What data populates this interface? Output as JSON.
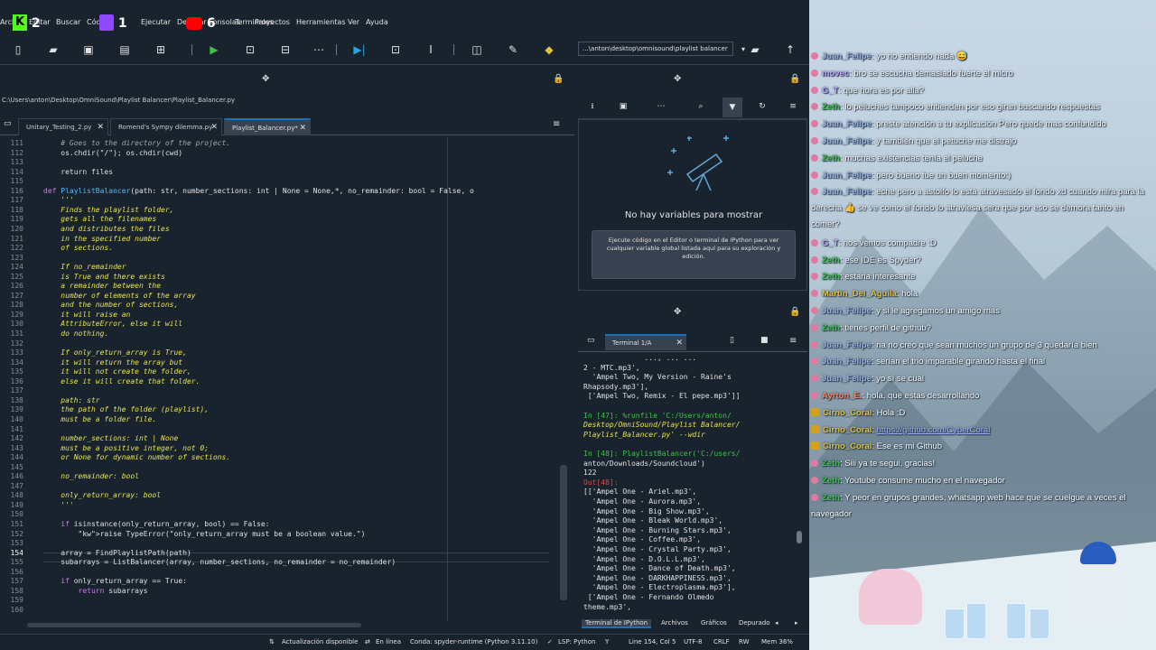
{
  "menu": {
    "items": [
      "Archivo",
      "Editar",
      "Buscar",
      "Código",
      "Ejecutar",
      "Depurar",
      "Consolas",
      "Terminales",
      "Proyectos",
      "Herramientas",
      "Ver",
      "Ayuda"
    ]
  },
  "overlay": {
    "k_count": "2",
    "tw_count": "1",
    "yt_count": "6"
  },
  "toolbar": {
    "path": "...\\anton\\desktop\\omnisound\\playlist balancer"
  },
  "editor": {
    "path": "C:\\Users\\anton\\Desktop\\OmniSound\\Playlist Balancer\\Playlist_Balancer.py",
    "tabs": [
      {
        "label": "Unitary_Testing_2.py"
      },
      {
        "label": "Romend's Sympy dilemma.py"
      },
      {
        "label": "Playlist_Balancer.py*"
      }
    ],
    "lines": [
      {
        "n": "111",
        "t": "    # Goes to the directory of the project.",
        "c": "cm"
      },
      {
        "n": "112",
        "t": "    os.chdir(\"/\"); os.chdir(cwd)",
        "c": ""
      },
      {
        "n": "113",
        "t": "",
        "c": ""
      },
      {
        "n": "114",
        "t": "    return files",
        "c": ""
      },
      {
        "n": "115",
        "t": "",
        "c": ""
      },
      {
        "n": "116",
        "t": "def PlaylistBalancer(path: str, number_sections: int | None = None,*, no_remainder: bool = False, o",
        "c": "def"
      },
      {
        "n": "117",
        "t": "    '''",
        "c": "doc"
      },
      {
        "n": "118",
        "t": "    Finds the playlist folder,",
        "c": "doc"
      },
      {
        "n": "119",
        "t": "    gets all the filenames",
        "c": "doc"
      },
      {
        "n": "120",
        "t": "    and distributes the files",
        "c": "doc"
      },
      {
        "n": "121",
        "t": "    in the specified number",
        "c": "doc"
      },
      {
        "n": "122",
        "t": "    of sections.",
        "c": "doc"
      },
      {
        "n": "123",
        "t": "",
        "c": ""
      },
      {
        "n": "124",
        "t": "    If no_remainder",
        "c": "doc"
      },
      {
        "n": "125",
        "t": "    is True and there exists",
        "c": "doc"
      },
      {
        "n": "126",
        "t": "    a remainder between the",
        "c": "doc"
      },
      {
        "n": "127",
        "t": "    number of elements of the array",
        "c": "doc"
      },
      {
        "n": "128",
        "t": "    and the number of sections,",
        "c": "doc"
      },
      {
        "n": "129",
        "t": "    it will raise an",
        "c": "doc"
      },
      {
        "n": "130",
        "t": "    AttributeError, else it will",
        "c": "doc"
      },
      {
        "n": "131",
        "t": "    do nothing.",
        "c": "doc"
      },
      {
        "n": "132",
        "t": "",
        "c": ""
      },
      {
        "n": "133",
        "t": "    If only_return_array is True,",
        "c": "doc"
      },
      {
        "n": "134",
        "t": "    it will return the array but",
        "c": "doc"
      },
      {
        "n": "135",
        "t": "    it will not create the folder,",
        "c": "doc"
      },
      {
        "n": "136",
        "t": "    else it will create that folder.",
        "c": "doc"
      },
      {
        "n": "137",
        "t": "",
        "c": ""
      },
      {
        "n": "138",
        "t": "    path: str",
        "c": "doc"
      },
      {
        "n": "139",
        "t": "    the path of the folder (playlist),",
        "c": "doc"
      },
      {
        "n": "140",
        "t": "    must be a folder file.",
        "c": "doc"
      },
      {
        "n": "141",
        "t": "",
        "c": ""
      },
      {
        "n": "142",
        "t": "    number_sections: int | None",
        "c": "doc"
      },
      {
        "n": "143",
        "t": "    must be a positive integer, not 0;",
        "c": "doc"
      },
      {
        "n": "144",
        "t": "    or None for dynamic number of sections.",
        "c": "doc"
      },
      {
        "n": "145",
        "t": "",
        "c": ""
      },
      {
        "n": "146",
        "t": "    no_remainder: bool",
        "c": "doc"
      },
      {
        "n": "147",
        "t": "",
        "c": ""
      },
      {
        "n": "148",
        "t": "    only_return_array: bool",
        "c": "doc"
      },
      {
        "n": "149",
        "t": "    '''",
        "c": "doc"
      },
      {
        "n": "150",
        "t": "",
        "c": ""
      },
      {
        "n": "151",
        "t": "    if isinstance(only_return_array, bool) == False:",
        "c": "if"
      },
      {
        "n": "152",
        "t": "        raise TypeError(\"only_return_array must be a boolean value.\")",
        "c": "raise"
      },
      {
        "n": "153",
        "t": "",
        "c": ""
      },
      {
        "n": "154",
        "t": "    array = FindPlaylistPath(path)",
        "c": ""
      },
      {
        "n": "155",
        "t": "    subarrays = ListBalancer(array, number_sections, no_remainder = no_remainder)",
        "c": ""
      },
      {
        "n": "156",
        "t": "",
        "c": ""
      },
      {
        "n": "157",
        "t": "    if only_return_array == True:",
        "c": "if"
      },
      {
        "n": "158",
        "t": "        return subarrays",
        "c": "ret"
      },
      {
        "n": "159",
        "t": "",
        "c": ""
      },
      {
        "n": "160",
        "t": "",
        "c": ""
      }
    ]
  },
  "variables": {
    "empty_title": "No hay variables para mostrar",
    "hint": "Ejecute código en el Editor o terminal de IPython para ver cualquier variable global listada aquí para su exploración y edición."
  },
  "terminal": {
    "tab": "Terminal 1/A",
    "lines": [
      {
        "t": "              ..., ... ...",
        "c": ""
      },
      {
        "t": "2 - MTC.mp3',",
        "c": ""
      },
      {
        "t": "  'Ampel Two, My Version - Raine's",
        "c": ""
      },
      {
        "t": "Rhapsody.mp3'],",
        "c": ""
      },
      {
        "t": " ['Ampel Two, Remix - El pepe.mp3']]",
        "c": ""
      },
      {
        "t": "",
        "c": ""
      },
      {
        "t": "In [47]: %runfile 'C:/Users/anton/",
        "c": "g"
      },
      {
        "t": "Desktop/OmniSound/Playlist Balancer/",
        "c": "y"
      },
      {
        "t": "Playlist_Balancer.py' --wdir",
        "c": "y"
      },
      {
        "t": "",
        "c": ""
      },
      {
        "t": "In [48]: PlaylistBalancer('C:/users/",
        "c": "g"
      },
      {
        "t": "anton/Downloads/Soundcloud')",
        "c": ""
      },
      {
        "t": "122",
        "c": ""
      },
      {
        "t": "Out[48]:",
        "c": "r"
      },
      {
        "t": "[['Ampel One - Ariel.mp3',",
        "c": ""
      },
      {
        "t": "  'Ampel One - Aurora.mp3',",
        "c": ""
      },
      {
        "t": "  'Ampel One - Big Show.mp3',",
        "c": ""
      },
      {
        "t": "  'Ampel One - Bleak World.mp3',",
        "c": ""
      },
      {
        "t": "  'Ampel One - Burning Stars.mp3',",
        "c": ""
      },
      {
        "t": "  'Ampel One - Coffee.mp3',",
        "c": ""
      },
      {
        "t": "  'Ampel One - Crystal Party.mp3',",
        "c": ""
      },
      {
        "t": "  'Ampel One - D.O.L.L.mp3',",
        "c": ""
      },
      {
        "t": "  'Ampel One - Dance of Death.mp3',",
        "c": ""
      },
      {
        "t": "  'Ampel One - DARKHAPPINESS.mp3',",
        "c": ""
      },
      {
        "t": "  'Ampel One - Electroplasma.mp3'],",
        "c": ""
      },
      {
        "t": " ['Ampel One - Fernando Olmedo",
        "c": ""
      },
      {
        "t": "theme.mp3',",
        "c": ""
      }
    ]
  },
  "bottom_tabs": [
    "Terminal de IPython",
    "Archivos",
    "Gráficos",
    "Depurador"
  ],
  "status": {
    "update": "Actualización disponible",
    "online": "En línea",
    "conda": "Conda: spyder-runtime (Python 3.11.10)",
    "lsp": "LSP: Python",
    "position": "Line 154, Col 5",
    "encoding": "UTF-8",
    "eol": "CRLF",
    "rw": "RW",
    "mem": "Mem 36%"
  },
  "chat": {
    "messages": [
      {
        "user": "Juan_Felipe",
        "text": ": yo no entiendo nada 😅",
        "color": "#9ab0e0",
        "badge": "dot"
      },
      {
        "user": "movec",
        "text": ": bro se escucha demasiado fuerte el micro",
        "color": "#c0a0ff",
        "badge": "dot"
      },
      {
        "user": "G_T",
        "text": ": que hora es por alla?",
        "color": "#c0a0ff",
        "badge": "dot"
      },
      {
        "user": "Zeth",
        "text": ": lo peluches tampoco entienden por eso giran buscando respuestas",
        "color": "#3ec04a",
        "badge": "dot"
      },
      {
        "user": "Juan_Felipe",
        "text": ": preste atención a tu explicación Pero quede mas confundido",
        "color": "#9ab0e0",
        "badge": "dot"
      },
      {
        "user": "Juan_Felipe",
        "text": ": y también que el petuche me distrajo",
        "color": "#9ab0e0",
        "badge": "dot"
      },
      {
        "user": "Zeth",
        "text": ": muchas existencias tenía el peluche",
        "color": "#3ec04a",
        "badge": "dot"
      },
      {
        "user": "Juan_Felipe",
        "text": ": pero bueno fue un buen momento:)",
        "color": "#9ab0e0",
        "badge": "dot"
      },
      {
        "user": "Juan_Felipe",
        "text": ": eche pero a astolfo lo está atravesado el fondo xd cuando mira para la derecha 👍 se ve como el fondo lo atraviesa sera que por eso se demora tanto en comer?",
        "color": "#9ab0e0",
        "badge": "dot"
      },
      {
        "user": "G_T",
        "text": ": nos vemos compadre :D",
        "color": "#c0a0ff",
        "badge": "dot"
      },
      {
        "user": "Zeth",
        "text": ": ese IDE es Spyder?",
        "color": "#3ec04a",
        "badge": "dot"
      },
      {
        "user": "Zeth",
        "text": ": estaria interesante",
        "color": "#3ec04a",
        "badge": "dot"
      },
      {
        "user": "Martin_Del_Aguila",
        "text": ": hola",
        "color": "#e0c040",
        "badge": "dot"
      },
      {
        "user": "Juan_Felipe",
        "text": ": y si le agregamos un amigo mas",
        "color": "#9ab0e0",
        "badge": "dot"
      },
      {
        "user": "Zeth",
        "text": ": tienes perfil de github?",
        "color": "#3ec04a",
        "badge": "dot"
      },
      {
        "user": "Juan_Felipe",
        "text": ": na no creo que sean muchos un grupo de 3 quedaría bien",
        "color": "#9ab0e0",
        "badge": "dot"
      },
      {
        "user": "Juan_Felipe",
        "text": ": serían el trio imparable girando hasta el final",
        "color": "#9ab0e0",
        "badge": "dot"
      },
      {
        "user": "Juan_Felipe",
        "text": ": yo sí se cuál",
        "color": "#9ab0e0",
        "badge": "dot"
      },
      {
        "user": "Ayrton_E.",
        "text": ": hola, que estas desarrollando",
        "color": "#ff8060",
        "badge": "dot"
      },
      {
        "user": "Cirno_Coral",
        "text": ": Hola :D",
        "color": "#e0c040",
        "badge": "sq"
      },
      {
        "user": "Cirno_Coral",
        "text": ": ",
        "link": "https://github.com/CyberCoral",
        "color": "#e0c040",
        "badge": "sq"
      },
      {
        "user": "Cirno_Coral",
        "text": ": Ese es mi Github",
        "color": "#e0c040",
        "badge": "sq"
      },
      {
        "user": "Zeth",
        "text": ": Siii ya te segui, gracias!",
        "color": "#3ec04a",
        "badge": "dot"
      },
      {
        "user": "Zeth",
        "text": ": Youtube consume mucho en el navegador",
        "color": "#3ec04a",
        "badge": "dot"
      },
      {
        "user": "Zeth",
        "text": ": Y peor en grupos grandes, whatsapp web hace que se cuelgue a veces el navegador",
        "color": "#3ec04a",
        "badge": "dot"
      }
    ]
  }
}
